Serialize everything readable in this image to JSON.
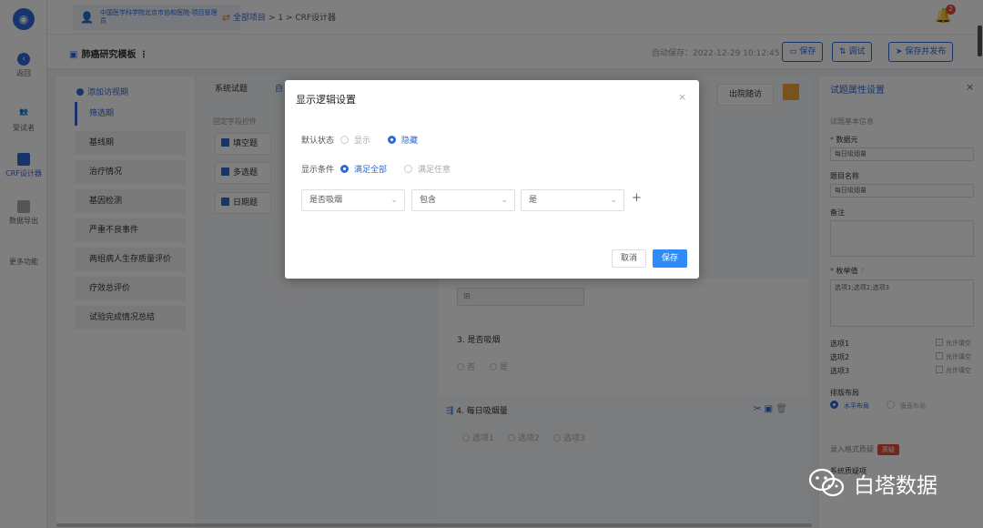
{
  "rail": {
    "back": "返回",
    "subjects": "受试者",
    "crf": "CRF设计器",
    "export": "数据导出",
    "more": "更多功能"
  },
  "header": {
    "org": "中国医学科学院北京市协和医院-项目管理员",
    "crumb_all": "全部项目",
    "crumb_sep1": ">",
    "crumb_num": "1",
    "crumb_sep2": ">",
    "crumb_page": "CRF设计器",
    "badge": "2"
  },
  "toolbar": {
    "template": "肺癌研究模板",
    "autosave": "自动保存：2022-12-29 10:12:45",
    "save": "保存",
    "debug": "调试",
    "publish": "保存并发布"
  },
  "visits": {
    "add": "添加访视期",
    "items": [
      "筛选期",
      "基线期",
      "治疗情况",
      "基因检测",
      "严重不良事件",
      "两组病人生存质量评价",
      "疗效总评价",
      "试验完成情况总结"
    ]
  },
  "components": {
    "tab_system": "系统试题",
    "tab_custom": "自",
    "section": "固定字段控件",
    "items": [
      "填空题",
      "多选题",
      "日期题"
    ]
  },
  "canvas": {
    "tab_track": "出院随访",
    "q3_title": "3. 是否吸烟",
    "q3_opt_yes": "否",
    "q3_opt_no": "是",
    "q4_title": "4. 每日吸烟量",
    "q4_opts": [
      "选项1",
      "选项2",
      "选项3"
    ]
  },
  "props": {
    "title": "试题属性设置",
    "basic": "试题基本信息",
    "label_var": "数据元",
    "var_value": "每日吸烟量",
    "label_name": "题目名称",
    "name_value": "每日吸烟量",
    "label_note": "备注",
    "label_options": "枚举值",
    "options_value": "选项1;选项2;选项3",
    "opts": [
      "选项1",
      "选项2",
      "选项3"
    ],
    "allow_fill": "允许填空",
    "layout": "排版布局",
    "layout_h": "水平布局",
    "layout_v": "垂直布局",
    "entry": "录入格式质疑",
    "entry_tag": "质疑",
    "sys_rule": "系统质疑项"
  },
  "modal": {
    "title": "显示逻辑设置",
    "default_label": "默认状态",
    "opt_show": "显示",
    "opt_hide": "隐藏",
    "cond_label": "显示条件",
    "opt_all": "满足全部",
    "opt_any": "满足任意",
    "sel_field": "是否吸烟",
    "sel_op": "包含",
    "sel_value": "是",
    "cancel": "取消",
    "save": "保存"
  },
  "watermark": {
    "text": "白塔数据"
  },
  "colors": {
    "accent": "#2f6bd8",
    "primary_button": "#2f8cf6",
    "danger": "#e24b3b"
  }
}
